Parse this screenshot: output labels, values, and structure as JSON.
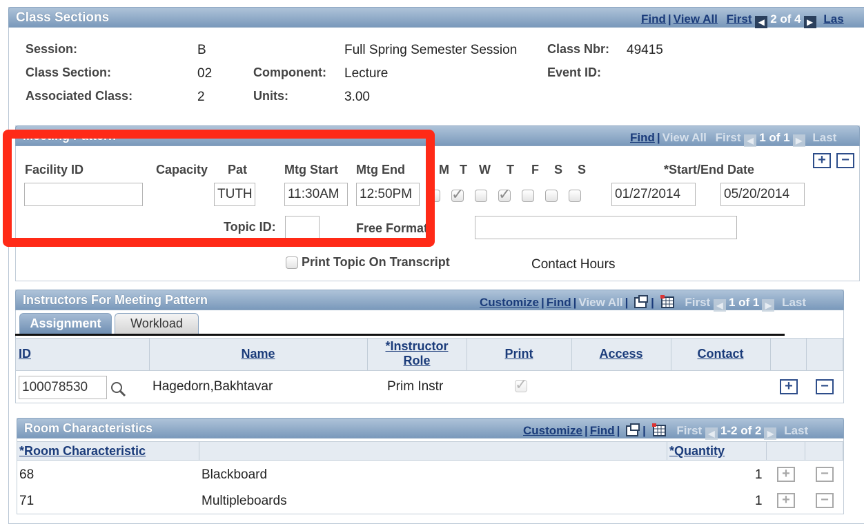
{
  "class_sections": {
    "title": "Class Sections",
    "nav": {
      "find": "Find",
      "view_all": "View All",
      "first": "First",
      "count": "2 of 4",
      "last": "Las"
    },
    "session_label": "Session:",
    "session_value": "B",
    "session_desc": "Full Spring Semester Session",
    "class_nbr_label": "Class Nbr:",
    "class_nbr_value": "49415",
    "class_section_label": "Class Section:",
    "class_section_value": "02",
    "component_label": "Component:",
    "component_value": "Lecture",
    "event_id_label": "Event ID:",
    "assoc_class_label": "Associated Class:",
    "assoc_class_value": "2",
    "units_label": "Units:",
    "units_value": "3.00"
  },
  "meeting_pattern": {
    "title": "Meeting Pattern",
    "nav": {
      "find": "Find",
      "view_all": "View All",
      "first": "First",
      "count": "1 of 1",
      "last": "Last"
    },
    "facility_label": "Facility ID",
    "facility_value": "",
    "capacity_label": "Capacity",
    "pat_label": "Pat",
    "pat_value": "TUTH",
    "start_label": "Mtg Start",
    "start_value": "11:30AM",
    "end_label": "Mtg End",
    "end_value": "12:50PM",
    "days": [
      "M",
      "T",
      "W",
      "T",
      "F",
      "S",
      "S"
    ],
    "days_checked": [
      false,
      true,
      false,
      true,
      false,
      false,
      false
    ],
    "date_label": "*Start/End Date",
    "start_date": "01/27/2014",
    "end_date": "05/20/2014",
    "topic_label": "Topic ID:",
    "topic_value": "",
    "free_topic_label": "Free Format Topic:",
    "free_topic_value": "",
    "print_topic_label": "Print Topic On Transcript",
    "contact_hours_label": "Contact Hours"
  },
  "instructors": {
    "title": "Instructors For Meeting Pattern",
    "nav": {
      "customize": "Customize",
      "find": "Find",
      "view_all": "View All",
      "first": "First",
      "count": "1 of 1",
      "last": "Last"
    },
    "tabs": [
      "Assignment",
      "Workload"
    ],
    "columns": [
      "ID",
      "Name",
      "*Instructor Role",
      "Print",
      "Access",
      "Contact"
    ],
    "row": {
      "id": "100078530",
      "name": "Hagedorn,Bakhtavar",
      "role": "Prim Instr",
      "print": true
    }
  },
  "room": {
    "title": "Room Characteristics",
    "nav": {
      "customize": "Customize",
      "find": "Find",
      "first": "First",
      "count": "1-2 of 2",
      "last": "Last"
    },
    "columns": [
      "*Room Characteristic",
      "*Quantity"
    ],
    "rows": [
      {
        "code": "68",
        "desc": "Blackboard",
        "qty": "1"
      },
      {
        "code": "71",
        "desc": "Multipleboards",
        "qty": "1"
      }
    ]
  },
  "colors": {
    "header_bar": "#7a99bb",
    "link": "#1a3b7a",
    "highlight": "#ff2a17"
  }
}
